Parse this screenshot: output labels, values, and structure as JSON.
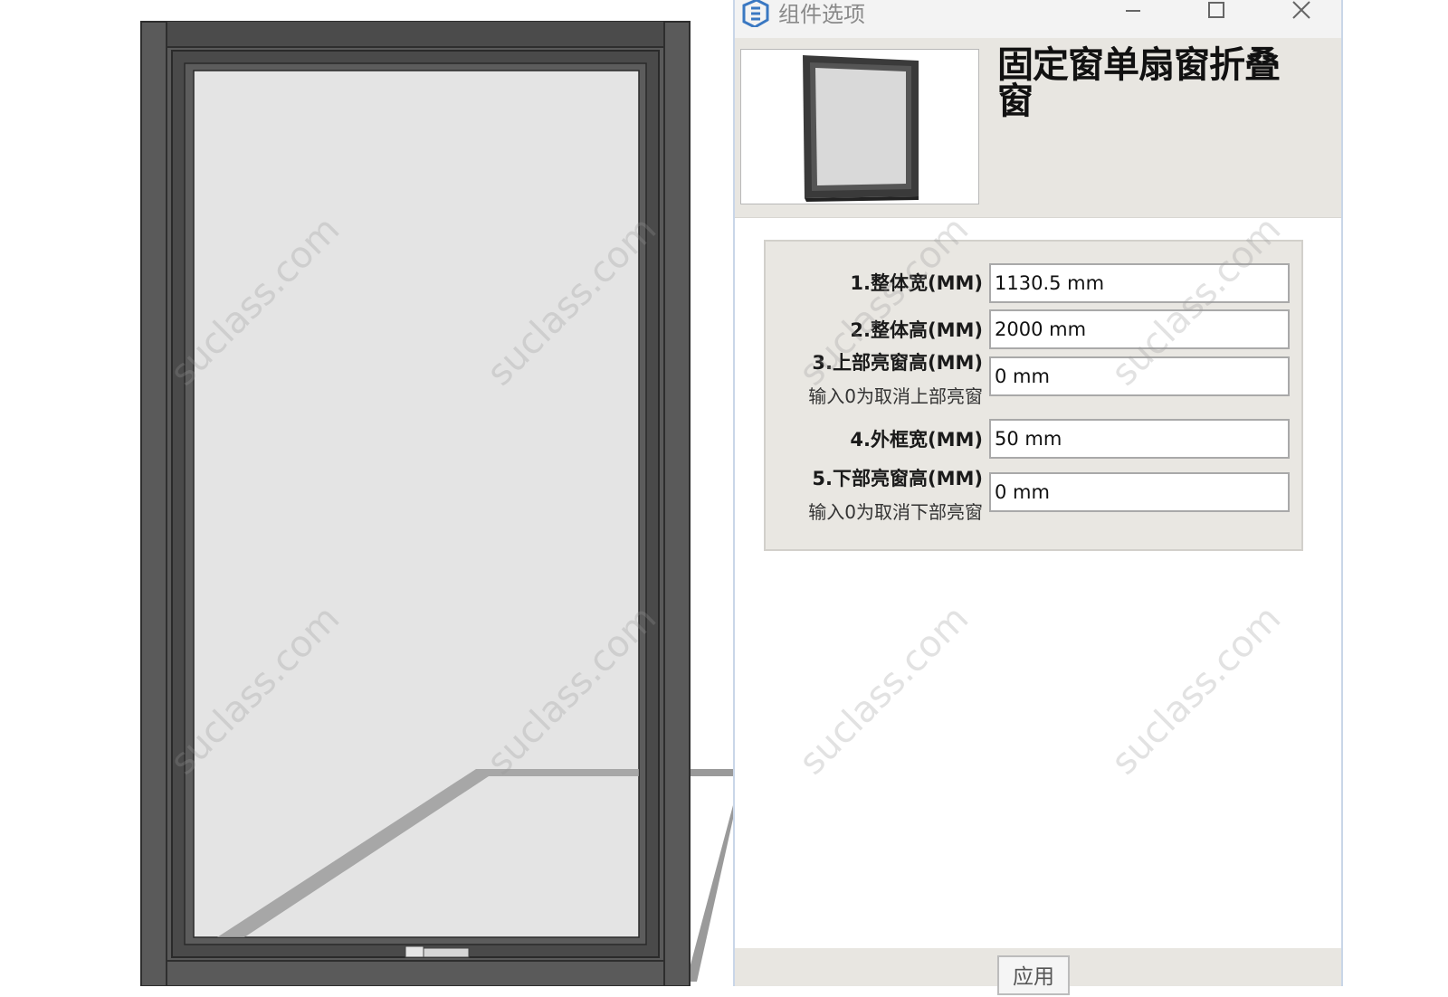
{
  "dialog": {
    "title": "组件选项",
    "component_name": "固定窗单扇窗折叠窗",
    "apply_label": "应用"
  },
  "options": [
    {
      "label": "1.整体宽(MM)",
      "hint": "",
      "value": "1130.5 mm"
    },
    {
      "label": "2.整体高(MM)",
      "hint": "",
      "value": "2000 mm"
    },
    {
      "label": "3.上部亮窗高(MM)",
      "hint": "输入0为取消上部亮窗",
      "value": "0 mm"
    },
    {
      "label": "4.外框宽(MM)",
      "hint": "",
      "value": "50 mm"
    },
    {
      "label": "5.下部亮窗高(MM)",
      "hint": "输入0为取消下部亮窗",
      "value": "0 mm"
    }
  ],
  "watermark": "suclass.com",
  "icons": {
    "app": "sketchup-logo-icon",
    "minimize": "minimize-icon",
    "maximize": "maximize-icon",
    "close": "close-icon"
  },
  "colors": {
    "frame": "#5a5a5a",
    "glass": "#e4e4e4",
    "panel": "#e8e6e1"
  }
}
